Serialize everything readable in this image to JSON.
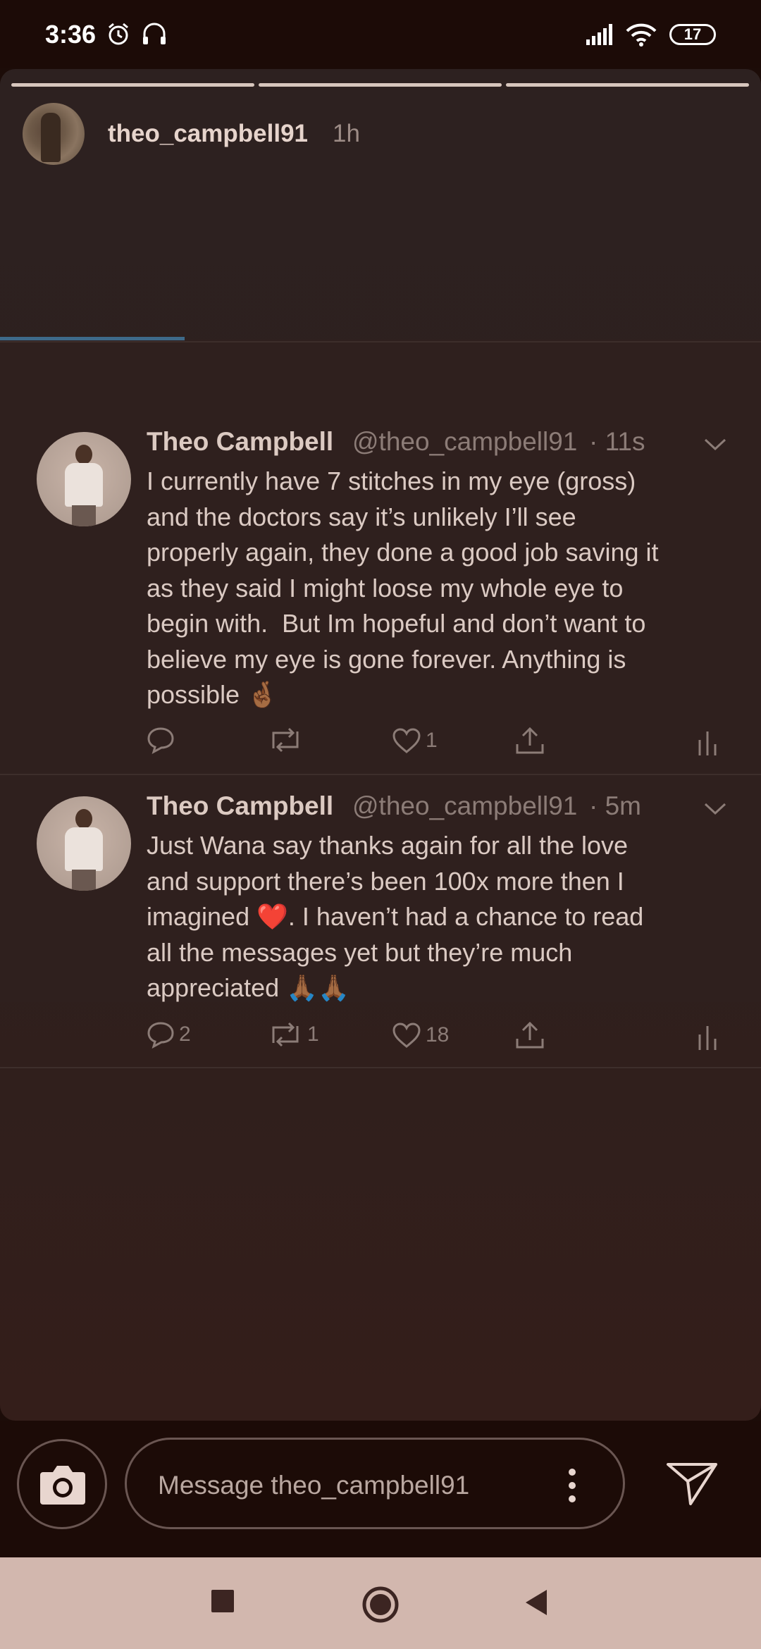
{
  "status_bar": {
    "time": "3:36",
    "icons": [
      "alarm-icon",
      "headset-icon",
      "signal-icon",
      "wifi-icon"
    ],
    "battery": "17"
  },
  "story": {
    "username": "theo_campbell91",
    "time_ago": "1h",
    "segments_count": 3
  },
  "tweets": [
    {
      "name": "Theo Campbell",
      "handle": "@theo_campbell91",
      "time": "· 11s",
      "text": "I currently have 7 stitches in my eye (gross)\nand the doctors say it’s unlikely I’ll see\nproperly again, they done a good job saving it\nas they said I might loose my whole eye to\nbegin with.  But Im hopeful and don’t want to\nbelieve my eye is gone forever. Anything is\npossible 🤞🏾",
      "replies": "",
      "retweets": "",
      "likes": "1"
    },
    {
      "name": "Theo Campbell",
      "handle": "@theo_campbell91",
      "time": "· 5m",
      "text": "Just Wana say thanks again for all the love\nand support there’s been 100x more then I\nimagined ❤️. I haven’t had a chance to read\nall the messages yet but they’re much\nappreciated 🙏🏾🙏🏾",
      "replies": "2",
      "retweets": "1",
      "likes": "18"
    }
  ],
  "reply_bar": {
    "placeholder": "Message theo_campbell91"
  },
  "colors": {
    "accent_progress": "#3e6a8a",
    "background": "#1c0c08",
    "nav_bar": "#d2b7ae"
  }
}
